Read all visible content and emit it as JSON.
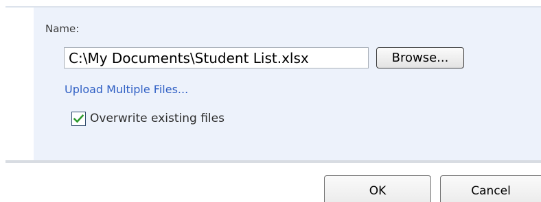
{
  "upload_form": {
    "name_label": "Name:",
    "file_path_value": "C:\\My Documents\\Student List.xlsx",
    "browse_label": "Browse...",
    "upload_multiple_link": "Upload Multiple Files...",
    "overwrite_label": "Overwrite existing files",
    "overwrite_checked": true
  },
  "dialog_buttons": {
    "ok_label": "OK",
    "cancel_label": "Cancel"
  },
  "colors": {
    "panel_background": "#edf2fb",
    "link": "#2f5fc4",
    "checkmark": "#2e9a2e"
  },
  "icons": {
    "checkbox": "checkmark-icon"
  }
}
